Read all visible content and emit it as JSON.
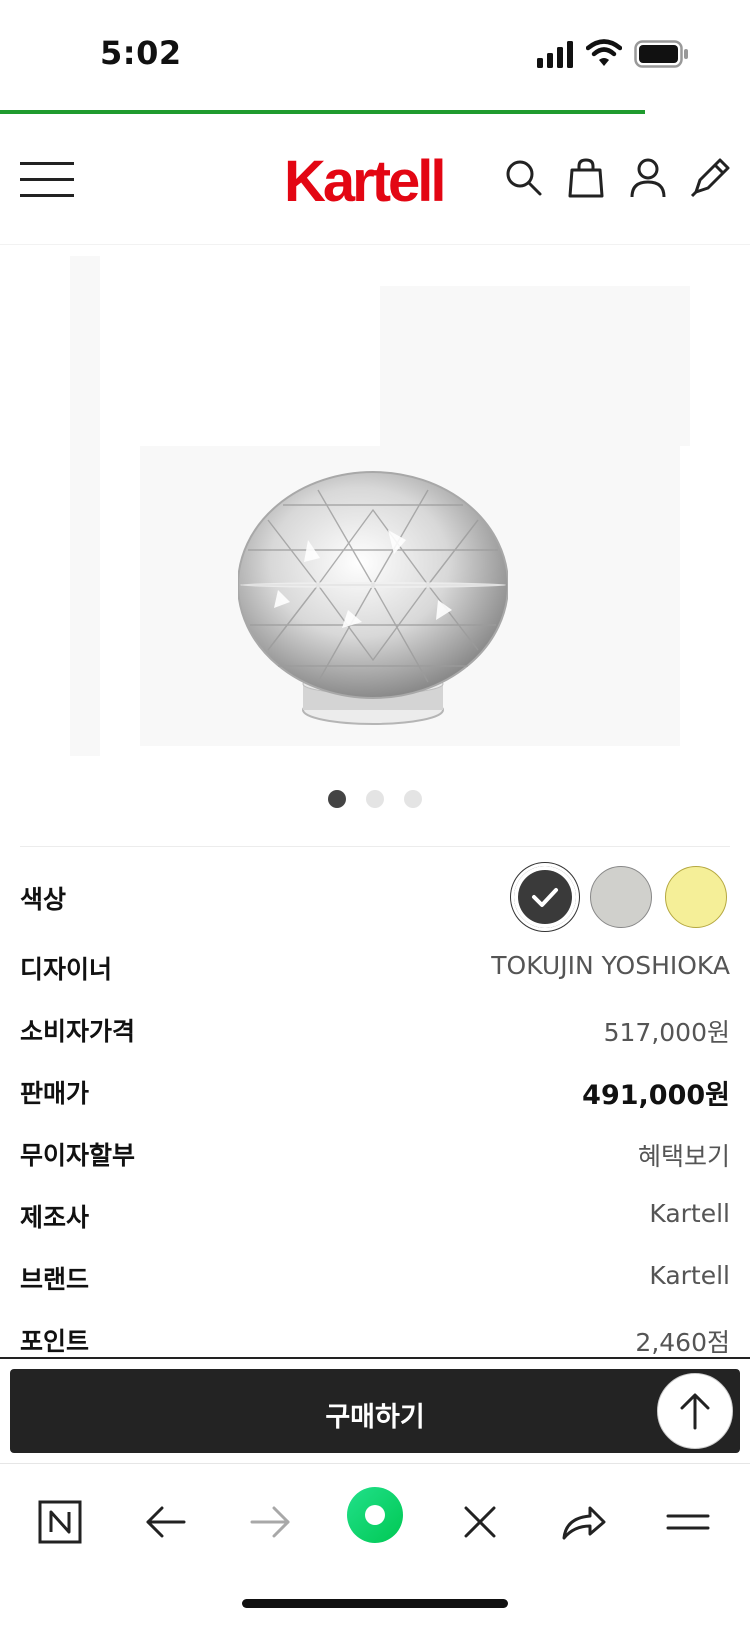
{
  "status_bar": {
    "time": "5:02"
  },
  "page_load_progress": 0.86,
  "header": {
    "brand": "Kartell",
    "brand_color": "#e30613"
  },
  "gallery": {
    "image_count": 3,
    "active_index": 0
  },
  "product": {
    "rows": [
      {
        "label": "색상",
        "value": ""
      },
      {
        "label": "디자이너",
        "value": "TOKUJIN YOSHIOKA"
      },
      {
        "label": "소비자가격",
        "value": "517,000원"
      },
      {
        "label": "판매가",
        "value": "491,000원"
      },
      {
        "label": "무이자할부",
        "value": "혜택보기"
      },
      {
        "label": "제조사",
        "value": "Kartell"
      },
      {
        "label": "브랜드",
        "value": "Kartell"
      },
      {
        "label": "포인트",
        "value": "2,460점"
      }
    ],
    "colors": [
      {
        "hex": "#3a3a3a",
        "selected": true
      },
      {
        "hex": "#d0d0cc",
        "selected": false
      },
      {
        "hex": "#f5ef98",
        "selected": false
      }
    ]
  },
  "buy_button": {
    "label": "구매하기"
  },
  "browser_toolbar": {
    "icons": [
      "naver-n-icon",
      "back-arrow-icon",
      "forward-arrow-icon",
      "green-dot-icon",
      "close-icon",
      "share-icon",
      "menu-icon"
    ]
  }
}
